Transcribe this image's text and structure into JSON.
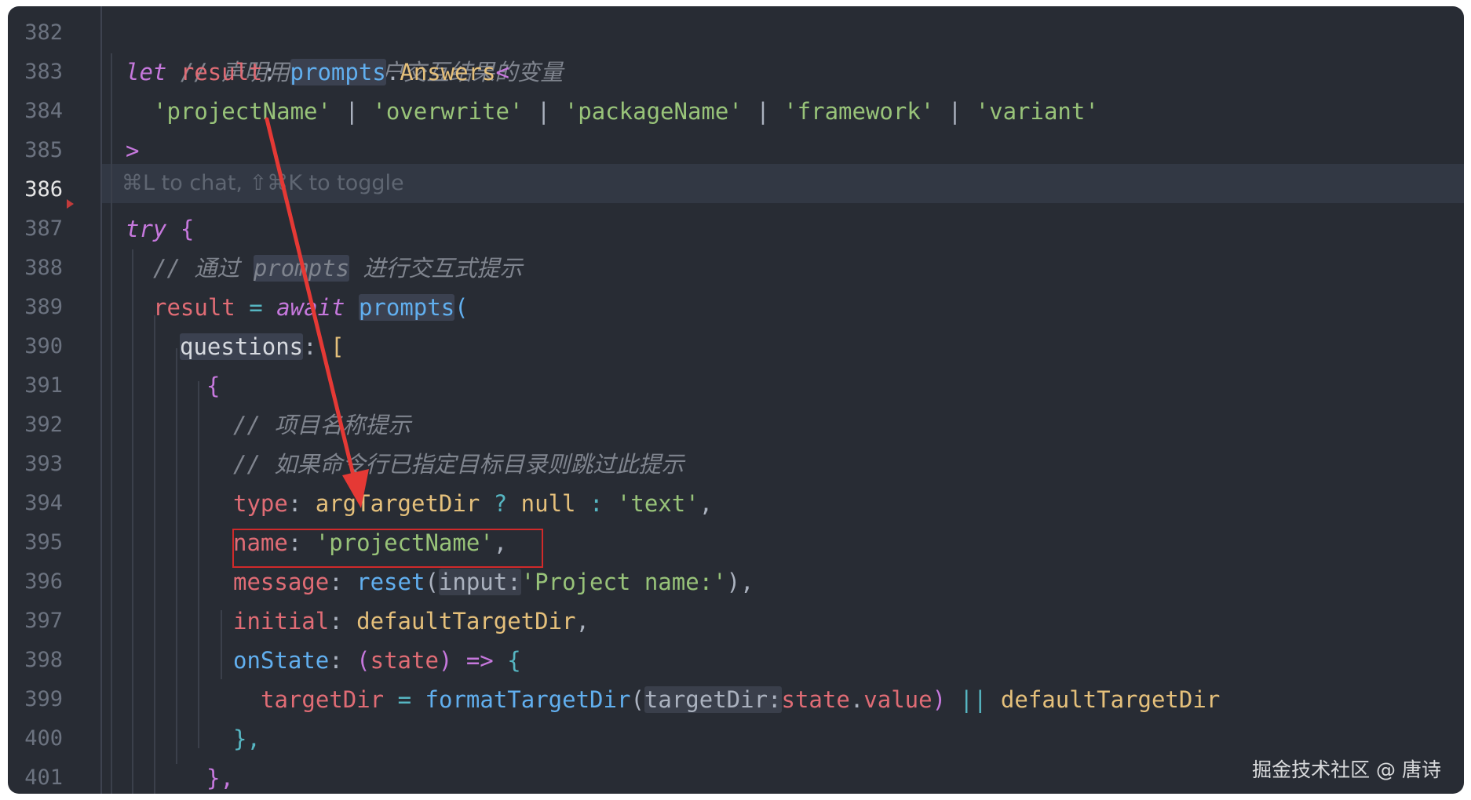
{
  "editor": {
    "active_line": "386",
    "inline_hint": "⌘L to chat, ⇧⌘K to toggle",
    "line_numbers": [
      "382",
      "383",
      "384",
      "385",
      "386",
      "387",
      "388",
      "389",
      "390",
      "391",
      "392",
      "393",
      "394",
      "395",
      "396",
      "397",
      "398",
      "399",
      "400",
      "401"
    ],
    "lines": {
      "l382": {
        "comment": "// 声明用于存储用户交互结果的变量"
      },
      "l383": {
        "let": "let",
        "result": "result",
        "colon": ": ",
        "prompts": "prompts",
        "dot": ".",
        "answers": "Answers",
        "lt": "<"
      },
      "l384": {
        "s1": "'projectName'",
        "s2": "'overwrite'",
        "s3": "'packageName'",
        "s4": "'framework'",
        "s5": "'variant'",
        "pipe": " | "
      },
      "l385": {
        "gt": ">"
      },
      "l387": {
        "try": "try",
        "brace": " {"
      },
      "l388": {
        "c1": "// 通过 ",
        "c2": "prompts",
        "c3": " 进行交互式提示"
      },
      "l389": {
        "result": "result",
        "eq": " = ",
        "await": "await",
        "prompts": "prompts",
        "paren": "("
      },
      "l390": {
        "questions": "questions",
        "colon": ": ",
        "bracket": "["
      },
      "l391": {
        "brace": "{"
      },
      "l392": {
        "comment": "// 项目名称提示"
      },
      "l393": {
        "comment": "// 如果命令行已指定目标目录则跳过此提示"
      },
      "l394": {
        "type": "type",
        "colon": ": ",
        "arg": "argTargetDir",
        "q": " ? ",
        "null": "null",
        "c": " : ",
        "text": "'text'",
        "comma": ","
      },
      "l395": {
        "name": "name",
        "colon": ": ",
        "val": "'projectName'",
        "comma": ","
      },
      "l396": {
        "message": "message",
        "colon": ": ",
        "reset": "reset",
        "open": "(",
        "hint": "input:",
        "str": "'Project name:'",
        "close": "),"
      },
      "l397": {
        "initial": "initial",
        "colon": ": ",
        "val": "defaultTargetDir",
        "comma": ","
      },
      "l398": {
        "onState": "onState",
        "colon": ": ",
        "open": "(",
        "state": "state",
        "close": ")",
        "arrow": " => ",
        "brace": "{"
      },
      "l399": {
        "target": "targetDir",
        "eq": " = ",
        "fn": "formatTargetDir",
        "open": "(",
        "hint": "targetDir:",
        "state": "state",
        "dot": ".",
        "value": "value",
        "close": ")",
        "or": " || ",
        "def": "defaultTargetDir"
      },
      "l400": {
        "close": "},"
      },
      "l401": {
        "close": "},"
      }
    }
  },
  "annotation": {
    "arrow_color": "#e53935",
    "box_color": "#d12a2a"
  },
  "watermark": "掘金技术社区 @ 唐诗",
  "colors": {
    "background": "#282c34",
    "keyword": "#c678dd",
    "string": "#98c379",
    "function": "#61afef",
    "variable": "#e06c75",
    "comment": "#7f848e"
  }
}
